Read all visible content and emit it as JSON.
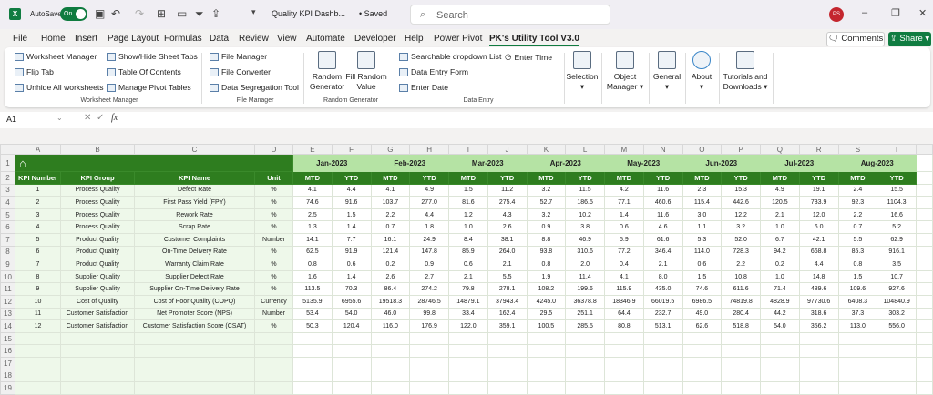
{
  "titlebar": {
    "app_icon": "excel-logo",
    "autosave_label": "AutoSave",
    "autosave_state": "On",
    "doc_title": "Quality KPI Dashb...",
    "saved": "• Saved",
    "search_placeholder": "Search",
    "avatar": "PS"
  },
  "menu_tabs": [
    "File",
    "Home",
    "Insert",
    "Page Layout",
    "Formulas",
    "Data",
    "Review",
    "View",
    "Automate",
    "Developer",
    "Help",
    "Power Pivot",
    "PK's Utility Tool V3.0"
  ],
  "active_tab": "PK's Utility Tool V3.0",
  "comments_label": "Comments",
  "share_label": "Share",
  "ribbon": {
    "worksheet_manager": {
      "label": "Worksheet Manager",
      "items": [
        "Worksheet Manager",
        "Flip Tab",
        "Unhide All worksheets",
        "Show/Hide Sheet Tabs",
        "Table Of Contents",
        "Manage Pivot Tables"
      ]
    },
    "file_manager": {
      "label": "File Manager",
      "items": [
        "File Manager",
        "File Converter",
        "Data Segregation Tool"
      ]
    },
    "random_generator": {
      "label": "Random Generator",
      "items": [
        "Random Generator",
        "Fill Random Value"
      ]
    },
    "data_entry": {
      "label": "Data Entry",
      "items": [
        "Searchable dropdown List",
        "Data Entry Form",
        "Enter Date",
        "Enter Time"
      ]
    },
    "big_buttons": [
      "Selection",
      "Object Manager",
      "General",
      "About",
      "Tutorials and Downloads"
    ]
  },
  "formula_bar": {
    "name_box": "A1",
    "fx": "fx",
    "value": ""
  },
  "columns": [
    "A",
    "B",
    "C",
    "D",
    "E",
    "F",
    "G",
    "H",
    "I",
    "J",
    "K",
    "L",
    "M",
    "N",
    "O",
    "P",
    "Q",
    "R",
    "S",
    "T"
  ],
  "headers": [
    "KPI Number",
    "KPI Group",
    "KPI Name",
    "Unit"
  ],
  "months": [
    "Jan-2023",
    "Feb-2023",
    "Mar-2023",
    "Apr-2023",
    "May-2023",
    "Jun-2023",
    "Jul-2023",
    "Aug-2023"
  ],
  "sub_headers": [
    "MTD",
    "YTD"
  ],
  "rows": [
    [
      "1",
      "Process Quality",
      "Defect Rate",
      "%",
      "4.1",
      "4.4",
      "4.1",
      "4.9",
      "1.5",
      "11.2",
      "3.2",
      "11.5",
      "4.2",
      "11.6",
      "2.3",
      "15.3",
      "4.9",
      "19.1",
      "2.4",
      "15.5"
    ],
    [
      "2",
      "Process Quality",
      "First Pass Yield (FPY)",
      "%",
      "74.6",
      "91.6",
      "103.7",
      "277.0",
      "81.6",
      "275.4",
      "52.7",
      "186.5",
      "77.1",
      "460.6",
      "115.4",
      "442.6",
      "120.5",
      "733.9",
      "92.3",
      "1104.3"
    ],
    [
      "3",
      "Process Quality",
      "Rework Rate",
      "%",
      "2.5",
      "1.5",
      "2.2",
      "4.4",
      "1.2",
      "4.3",
      "3.2",
      "10.2",
      "1.4",
      "11.6",
      "3.0",
      "12.2",
      "2.1",
      "12.0",
      "2.2",
      "16.6"
    ],
    [
      "4",
      "Process Quality",
      "Scrap Rate",
      "%",
      "1.3",
      "1.4",
      "0.7",
      "1.8",
      "1.0",
      "2.6",
      "0.9",
      "3.8",
      "0.6",
      "4.6",
      "1.1",
      "3.2",
      "1.0",
      "6.0",
      "0.7",
      "5.2"
    ],
    [
      "5",
      "Product Quality",
      "Customer Complaints",
      "Number",
      "14.1",
      "7.7",
      "16.1",
      "24.9",
      "8.4",
      "38.1",
      "8.8",
      "46.9",
      "5.9",
      "61.6",
      "5.3",
      "52.0",
      "6.7",
      "42.1",
      "5.5",
      "62.9"
    ],
    [
      "6",
      "Product Quality",
      "On-Time Delivery Rate",
      "%",
      "62.5",
      "91.9",
      "121.4",
      "147.8",
      "85.9",
      "264.0",
      "93.8",
      "310.6",
      "77.2",
      "346.4",
      "114.0",
      "728.3",
      "94.2",
      "668.8",
      "85.3",
      "916.1"
    ],
    [
      "7",
      "Product Quality",
      "Warranty Claim Rate",
      "%",
      "0.8",
      "0.6",
      "0.2",
      "0.9",
      "0.6",
      "2.1",
      "0.8",
      "2.0",
      "0.4",
      "2.1",
      "0.6",
      "2.2",
      "0.2",
      "4.4",
      "0.8",
      "3.5"
    ],
    [
      "8",
      "Supplier Quality",
      "Supplier Defect Rate",
      "%",
      "1.6",
      "1.4",
      "2.6",
      "2.7",
      "2.1",
      "5.5",
      "1.9",
      "11.4",
      "4.1",
      "8.0",
      "1.5",
      "10.8",
      "1.0",
      "14.8",
      "1.5",
      "10.7"
    ],
    [
      "9",
      "Supplier Quality",
      "Supplier On-Time Delivery Rate",
      "%",
      "113.5",
      "70.3",
      "86.4",
      "274.2",
      "79.8",
      "278.1",
      "108.2",
      "199.6",
      "115.9",
      "435.0",
      "74.6",
      "611.6",
      "71.4",
      "489.6",
      "109.6",
      "927.6"
    ],
    [
      "10",
      "Cost of Quality",
      "Cost of Poor Quality (COPQ)",
      "Currency",
      "5135.9",
      "6955.6",
      "19518.3",
      "28746.5",
      "14879.1",
      "37943.4",
      "4245.0",
      "36378.8",
      "18346.9",
      "66019.5",
      "6986.5",
      "74819.8",
      "4828.9",
      "97730.6",
      "6408.3",
      "104840.9"
    ],
    [
      "11",
      "Customer Satisfaction",
      "Net Promoter Score (NPS)",
      "Number",
      "53.4",
      "54.0",
      "46.0",
      "99.8",
      "33.4",
      "162.4",
      "29.5",
      "251.1",
      "64.4",
      "232.7",
      "49.0",
      "280.4",
      "44.2",
      "318.6",
      "37.3",
      "303.2"
    ],
    [
      "12",
      "Customer Satisfaction",
      "Customer Satisfaction Score (CSAT)",
      "%",
      "50.3",
      "120.4",
      "116.0",
      "176.9",
      "122.0",
      "359.1",
      "100.5",
      "285.5",
      "80.8",
      "513.1",
      "62.6",
      "518.8",
      "54.0",
      "356.2",
      "113.0",
      "556.0"
    ]
  ],
  "empty_rows": [
    "15",
    "16",
    "17",
    "18",
    "19"
  ]
}
